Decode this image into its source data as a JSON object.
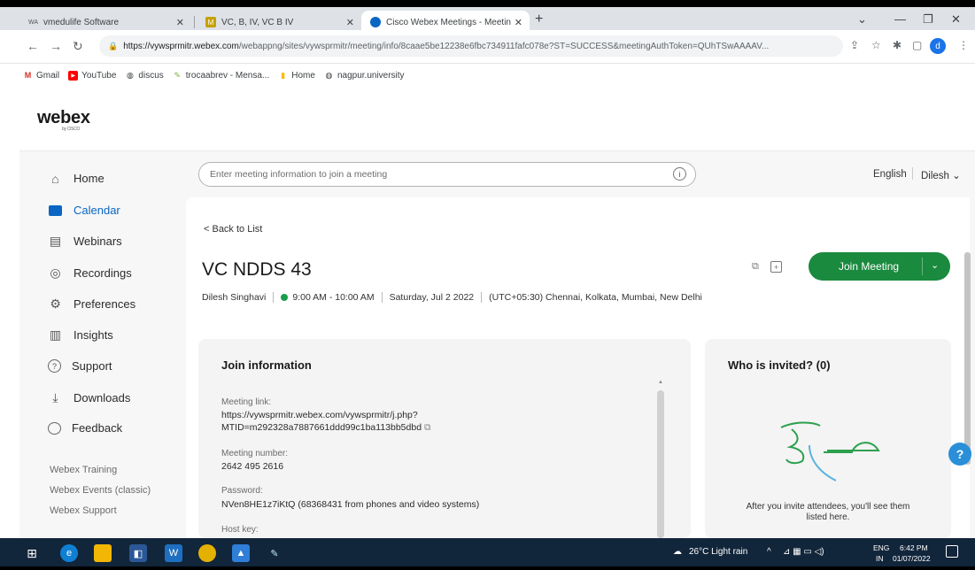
{
  "browser": {
    "tabs": [
      {
        "label": "vmedulife Software",
        "favicon": "WA"
      },
      {
        "label": "VC, B, IV, VC B IV",
        "favicon": "M"
      },
      {
        "label": "Cisco Webex Meetings - Meetin",
        "favicon": "webex-icon"
      }
    ],
    "new_tab": "+",
    "url_host": "https://vywsprmitr.webex.com",
    "url_path": "/webappng/sites/vywsprmitr/meeting/info/8caae5be12238e6fbc734911fafc078e?ST=SUCCESS&meetingAuthToken=QUhTSwAAAAV...",
    "profile_initial": "d",
    "bookmarks": [
      {
        "label": "Gmail",
        "icon": "M",
        "color": "#d93025"
      },
      {
        "label": "YouTube",
        "icon": "▶",
        "color": "#ff0000"
      },
      {
        "label": "discus",
        "icon": "globe-icon",
        "color": "#5f6368"
      },
      {
        "label": "trocaabrev - Mensa...",
        "icon": "leaf-icon",
        "color": "#7cb342"
      },
      {
        "label": "Home",
        "icon": "home-icon",
        "color": "#fbbc04"
      },
      {
        "label": "nagpur.university",
        "icon": "globe-icon",
        "color": "#5f6368"
      }
    ]
  },
  "app": {
    "logo": "webex",
    "logo_sub": "by CISCO",
    "nav": [
      {
        "label": "Home",
        "icon": "home-icon"
      },
      {
        "label": "Calendar",
        "icon": "calendar-icon",
        "active": true
      },
      {
        "label": "Webinars",
        "icon": "webinar-icon"
      },
      {
        "label": "Recordings",
        "icon": "record-icon"
      },
      {
        "label": "Preferences",
        "icon": "gear-icon"
      },
      {
        "label": "Insights",
        "icon": "insights-icon"
      },
      {
        "label": "Support",
        "icon": "help-icon"
      },
      {
        "label": "Downloads",
        "icon": "download-icon"
      },
      {
        "label": "Feedback",
        "icon": "feedback-icon"
      }
    ],
    "footer_links": [
      "Webex Training",
      "Webex Events (classic)",
      "Webex Support"
    ],
    "search_placeholder": "Enter meeting information to join a meeting",
    "language": "English",
    "user": "Dilesh",
    "back_link": "< Back to List",
    "meeting": {
      "title": "VC NDDS 43",
      "host": "Dilesh Singhavi",
      "time": "9:00 AM - 10:00 AM",
      "date": "Saturday, Jul 2 2022",
      "timezone": "(UTC+05:30) Chennai, Kolkata, Mumbai, New Delhi",
      "join_button": "Join Meeting"
    },
    "join_info": {
      "heading": "Join information",
      "link_label": "Meeting link:",
      "link_line1": "https://vywsprmitr.webex.com/vywsprmitr/j.php?",
      "link_line2": "MTID=m292328a7887661ddd99c1ba113bb5dbd",
      "number_label": "Meeting number:",
      "number": "2642 495 2616",
      "password_label": "Password:",
      "password": "NVen8HE1z7iKtQ (68368431 from phones and video systems)",
      "hostkey_label": "Host key:"
    },
    "invited": {
      "heading": "Who is invited? (0)",
      "empty_line1": "After you invite attendees, you'll see them",
      "empty_line2": "listed here."
    },
    "help_button": "?"
  },
  "taskbar": {
    "weather": "26°C  Light rain",
    "lang_top": "ENG",
    "lang_bottom": "IN",
    "time": "6:42 PM",
    "date": "01/07/2022"
  }
}
